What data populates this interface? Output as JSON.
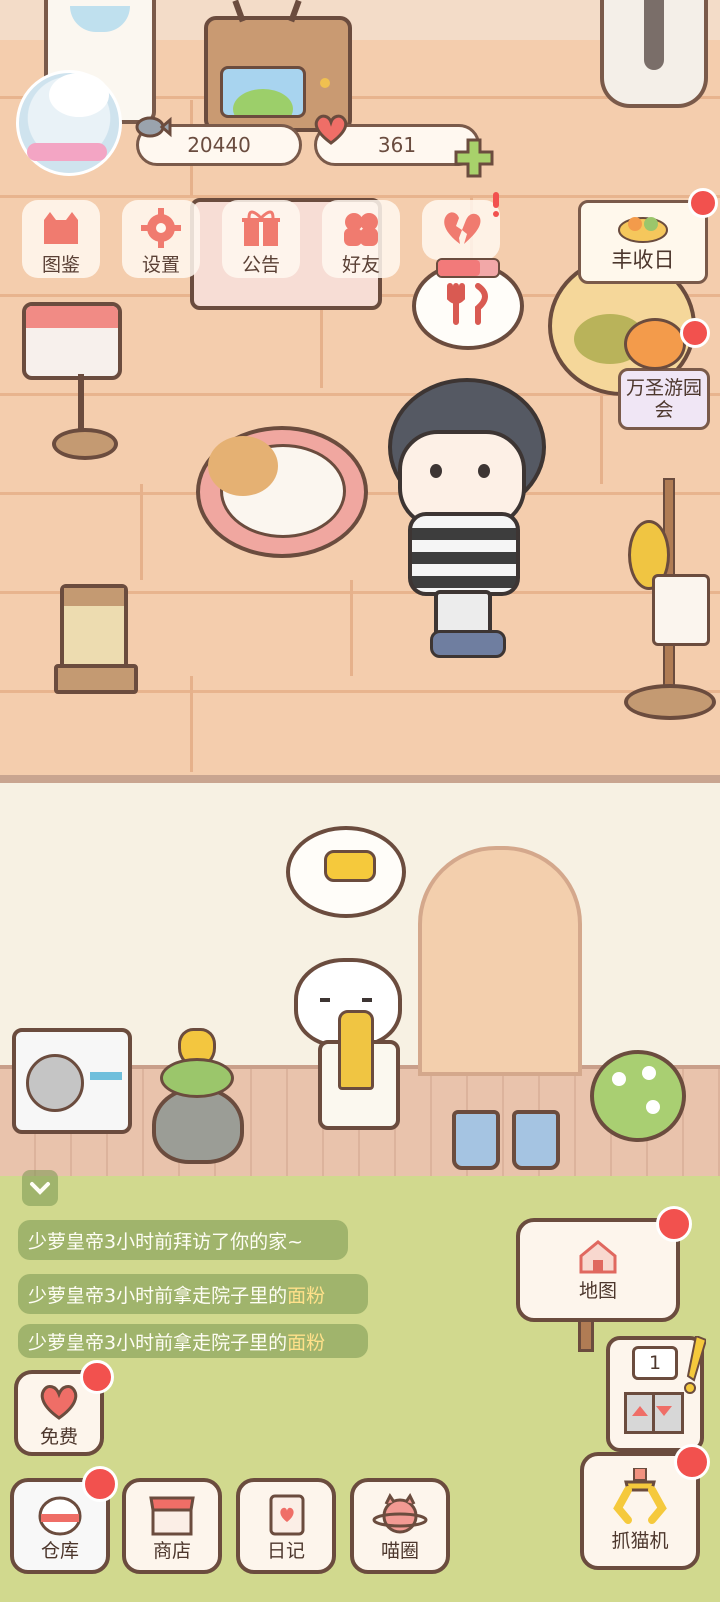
{
  "hud": {
    "currency1_value": "20440",
    "currency2_value": "361",
    "menu": [
      {
        "label": "图鉴",
        "icon": "cat-book-icon"
      },
      {
        "label": "设置",
        "icon": "gear-icon"
      },
      {
        "label": "公告",
        "icon": "gift-icon"
      },
      {
        "label": "好友",
        "icon": "friends-icon"
      },
      {
        "label": "",
        "icon": "broken-heart-icon"
      }
    ],
    "events": {
      "harvest_label": "丰收日",
      "halloween_label": "万圣游园会"
    }
  },
  "feed": [
    {
      "text": "少萝皇帝3小时前拜访了你的家~",
      "highlight": ""
    },
    {
      "text": "少萝皇帝3小时前拿走院子里的",
      "highlight": "面粉"
    },
    {
      "text": "少萝皇帝3小时前拿走院子里的",
      "highlight": "面粉"
    }
  ],
  "map": {
    "label": "地图"
  },
  "elevator": {
    "floor": "1"
  },
  "bottom_nav": {
    "free": "免费",
    "warehouse": "仓库",
    "shop": "商店",
    "diary": "日记",
    "meow_circle": "喵圈",
    "claw_machine": "抓猫机"
  },
  "colors": {
    "floor": "#f4cdad",
    "yard_wall": "#f7f1e3",
    "grass": "#d1d98e",
    "notification_dot": "#f2514e",
    "outline": "#6b4c3e"
  }
}
